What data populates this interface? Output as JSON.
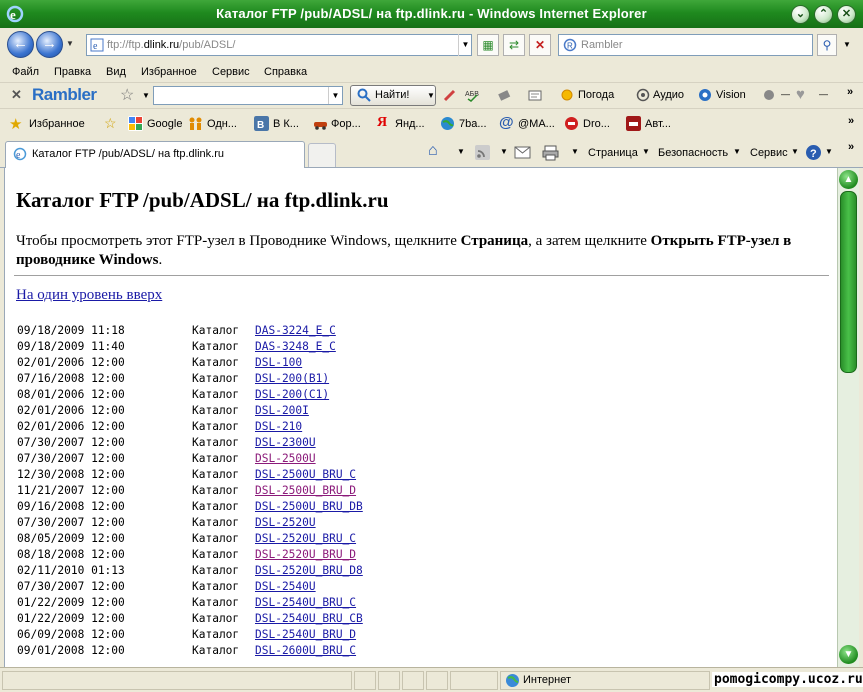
{
  "window": {
    "title": "Каталог FTP /pub/ADSL/ на ftp.dlink.ru - Windows Internet Explorer"
  },
  "address": {
    "url_prefix": "ftp://ftp.",
    "url_host": "dlink.ru",
    "url_path": "/pub/ADSL/",
    "search_placeholder": "Rambler"
  },
  "menu": {
    "items": [
      "Файл",
      "Правка",
      "Вид",
      "Избранное",
      "Сервис",
      "Справка"
    ]
  },
  "rambler_toolbar": {
    "logo": "Rambler",
    "find_label": "Найти!",
    "weather_label": "Погода",
    "audio_label": "Аудио",
    "vision_label": "Vision"
  },
  "favorites": {
    "label": "Избранное",
    "items": [
      "Google",
      "Одн...",
      "В К...",
      "Фор...",
      "Янд...",
      "7ba...",
      "@MA...",
      "Dro...",
      "Авт..."
    ]
  },
  "tabs": {
    "active_label": "Каталог FTP /pub/ADSL/ на ftp.dlink.ru",
    "page_label": "Страница",
    "security_label": "Безопасность",
    "service_label": "Сервис"
  },
  "content": {
    "heading": "Каталог FTP /pub/ADSL/ на ftp.dlink.ru",
    "intro_part1": "Чтобы просмотреть этот FTP-узел в Проводнике Windows, щелкните ",
    "intro_bold1": "Страница",
    "intro_part2": ", а затем щелкните ",
    "intro_bold2": "Открыть FTP-узел в проводнике Windows",
    "intro_part3": ".",
    "up_link": "На один уровень вверх",
    "entries": [
      {
        "date": "09/18/2009 11:18",
        "kind": "Каталог",
        "name": "DAS-3224_E_C",
        "visited": false
      },
      {
        "date": "09/18/2009 11:40",
        "kind": "Каталог",
        "name": "DAS-3248_E_C",
        "visited": false
      },
      {
        "date": "02/01/2006 12:00",
        "kind": "Каталог",
        "name": "DSL-100",
        "visited": false
      },
      {
        "date": "07/16/2008 12:00",
        "kind": "Каталог",
        "name": "DSL-200(B1)",
        "visited": false
      },
      {
        "date": "08/01/2006 12:00",
        "kind": "Каталог",
        "name": "DSL-200(C1)",
        "visited": false
      },
      {
        "date": "02/01/2006 12:00",
        "kind": "Каталог",
        "name": "DSL-200I",
        "visited": false
      },
      {
        "date": "02/01/2006 12:00",
        "kind": "Каталог",
        "name": "DSL-210",
        "visited": false
      },
      {
        "date": "07/30/2007 12:00",
        "kind": "Каталог",
        "name": "DSL-2300U",
        "visited": false
      },
      {
        "date": "07/30/2007 12:00",
        "kind": "Каталог",
        "name": "DSL-2500U",
        "visited": true
      },
      {
        "date": "12/30/2008 12:00",
        "kind": "Каталог",
        "name": "DSL-2500U_BRU_C",
        "visited": false
      },
      {
        "date": "11/21/2007 12:00",
        "kind": "Каталог",
        "name": "DSL-2500U_BRU_D",
        "visited": true
      },
      {
        "date": "09/16/2008 12:00",
        "kind": "Каталог",
        "name": "DSL-2500U_BRU_DB",
        "visited": false
      },
      {
        "date": "07/30/2007 12:00",
        "kind": "Каталог",
        "name": "DSL-2520U",
        "visited": false
      },
      {
        "date": "08/05/2009 12:00",
        "kind": "Каталог",
        "name": "DSL-2520U_BRU_C",
        "visited": false
      },
      {
        "date": "08/18/2008 12:00",
        "kind": "Каталог",
        "name": "DSL-2520U_BRU_D",
        "visited": true
      },
      {
        "date": "02/11/2010 01:13",
        "kind": "Каталог",
        "name": "DSL-2520U_BRU_D8",
        "visited": false
      },
      {
        "date": "07/30/2007 12:00",
        "kind": "Каталог",
        "name": "DSL-2540U",
        "visited": false
      },
      {
        "date": "01/22/2009 12:00",
        "kind": "Каталог",
        "name": "DSL-2540U_BRU_C",
        "visited": false
      },
      {
        "date": "01/22/2009 12:00",
        "kind": "Каталог",
        "name": "DSL-2540U_BRU_CB",
        "visited": false
      },
      {
        "date": "06/09/2008 12:00",
        "kind": "Каталог",
        "name": "DSL-2540U_BRU_D",
        "visited": false
      },
      {
        "date": "09/01/2008 12:00",
        "kind": "Каталог",
        "name": "DSL-2600U_BRU_C",
        "visited": false
      }
    ]
  },
  "status": {
    "zone": "Интернет",
    "watermark": "pomogicompy.ucoz.ru"
  },
  "colors": {
    "title_green": "#1f8a1f",
    "link": "#1a1aa6",
    "visited_link": "#8b1a7a"
  }
}
